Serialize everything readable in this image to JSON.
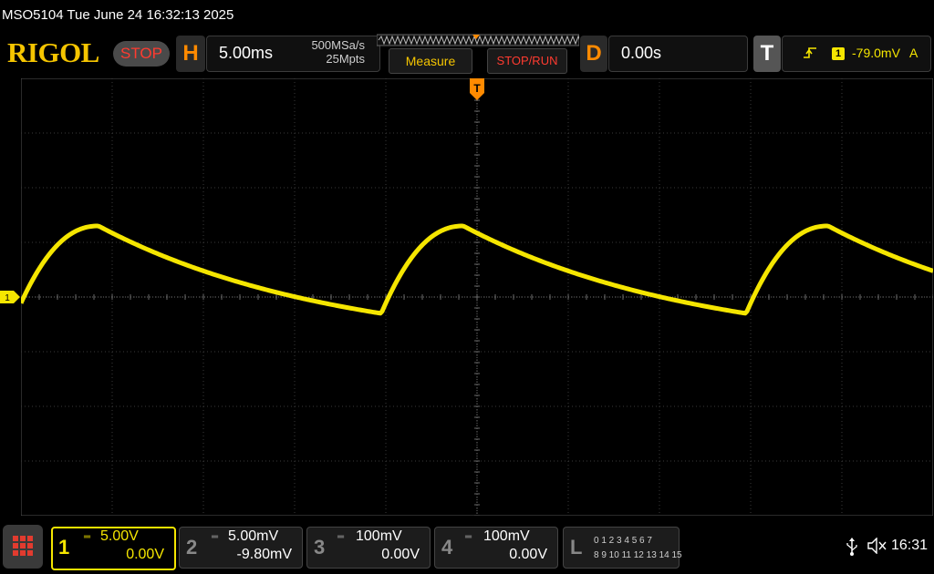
{
  "status": {
    "text": "MSO5104  Tue June 24 16:32:13 2025"
  },
  "header": {
    "logo": "RIGOL",
    "run_state": "STOP",
    "horizontal": {
      "tag": "H",
      "scale": "5.00ms",
      "sample_rate": "500MSa/s",
      "memory_depth": "25Mpts"
    },
    "measure_label": "Measure",
    "stoprun_label": "STOP/RUN",
    "delay": {
      "tag": "D",
      "value": "0.00s"
    },
    "trigger": {
      "tag": "T",
      "source": "1",
      "level": "-79.0mV",
      "mode": "A"
    }
  },
  "graticule": {
    "ch1_marker": "1",
    "trigger_marker": "T"
  },
  "channels": [
    {
      "num": "1",
      "scale": "5.00V",
      "offset": "0.00V",
      "color": "#f5e600",
      "active": true
    },
    {
      "num": "2",
      "scale": "5.00mV",
      "offset": "-9.80mV",
      "color": "#888888",
      "active": false
    },
    {
      "num": "3",
      "scale": "100mV",
      "offset": "0.00V",
      "color": "#888888",
      "active": false
    },
    {
      "num": "4",
      "scale": "100mV",
      "offset": "0.00V",
      "color": "#888888",
      "active": false
    }
  ],
  "logic": {
    "tag": "L",
    "row1": "0 1 2 3   4 5 6 7",
    "row2": "8 9 10 11  12 13 14 15"
  },
  "clock": "16:31",
  "colors": {
    "trace": "#f5e600",
    "accent_orange": "#ff8a00",
    "stop_red": "#ff3b30",
    "logo_yellow": "#f5c500"
  },
  "icons": {
    "menu": "grid-menu-icon",
    "usb": "usb-icon",
    "speaker": "speaker-muted-icon",
    "trigger_edge": "trigger-rising-edge-icon"
  }
}
